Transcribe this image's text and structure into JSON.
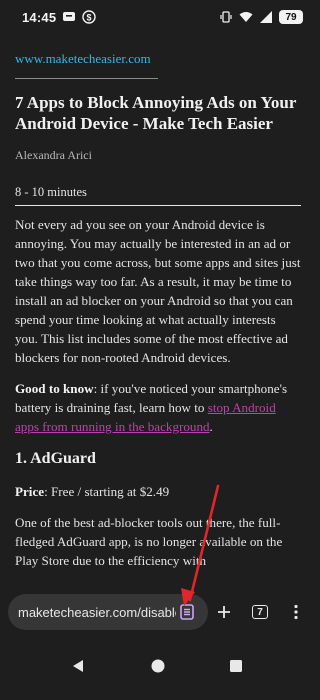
{
  "statusbar": {
    "time": "14:45",
    "battery": "79"
  },
  "article": {
    "site": "www.maketecheasier.com",
    "title": "7 Apps to Block Annoying Ads on Your Android Device - Make Tech Easier",
    "author": "Alexandra Arici",
    "read_time": "8 - 10 minutes",
    "para1": "Not every ad you see on your Android device is annoying. You may actually be interested in an ad or two that you come across, but some apps and sites just take things way too far. As a result, it may be time to install an ad blocker on your Android so that you can spend your time looking at what actually interests you. This list includes some of the most effective ad blockers for non-rooted Android devices.",
    "good_to_know_label": "Good to know",
    "good_to_know_text": ": if you've noticed your smartphone's battery is draining fast, learn how to ",
    "good_to_know_link": "stop Android apps from running in the background",
    "good_to_know_end": ".",
    "h2": "1. AdGuard",
    "price_label": "Price",
    "price_text": ": Free / starting at $2.49",
    "para3": "One of the best ad-blocker tools out there, the full-fledged AdGuard app, is no longer available on the Play Store due to the efficiency with"
  },
  "toolbar": {
    "url": "maketecheasier.com/disable",
    "tab_count": "7"
  },
  "colors": {
    "background": "#1e1e1e",
    "link_blue": "#39b6e4",
    "link_purple": "#c03fb3",
    "reader_icon": "#c9a7f0",
    "annotation_arrow": "#e0262a"
  },
  "icons": {
    "reader_mode": "reader-mode-icon",
    "new_tab": "plus-icon",
    "menu": "more-vertical-icon",
    "nav_back": "triangle-back-icon",
    "nav_home": "circle-home-icon",
    "nav_recents": "square-recents-icon"
  }
}
